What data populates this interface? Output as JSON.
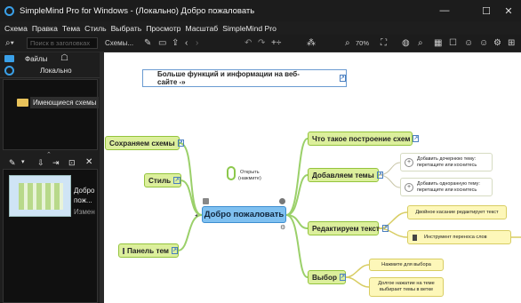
{
  "window": {
    "title": "SimpleMind Pro for Windows - (Локально) Добро пожаловать",
    "controls": [
      "—",
      "☐",
      "✕"
    ]
  },
  "menu": [
    "Схема",
    "Правка",
    "Тема",
    "Стиль",
    "Выбрать",
    "Просмотр",
    "Масштаб",
    "SimpleMind Pro"
  ],
  "toolbar": {
    "search_placeholder": "Поиск в заголовках",
    "maps_label": "Схемы...",
    "zoom": "70%"
  },
  "sidebar": {
    "files_label": "Файлы",
    "local_label": "Локально",
    "existing_maps": "Имеющиеся схемы",
    "thumb_lines": [
      "Добро",
      "пож...",
      "Измен"
    ]
  },
  "map": {
    "banner": "Больше функций и информации на веб-сайте -»",
    "central": "Добро пожаловать",
    "open_hint": [
      "Открыть",
      "(нажмите)"
    ],
    "left_topics": {
      "save": "Сохраняем схемы",
      "style": "Стиль",
      "panel": "Панель тем"
    },
    "right_topics": {
      "what": "Что такое построение схем",
      "add": "Добавляем темы",
      "edit": "Редактируем текст",
      "select": "Выбор"
    },
    "subs": {
      "child": "Добавить дочернюю тему: перетащите или коснитесь",
      "sibling": "Добавить одноранную тему: перетащите или коснитесь"
    },
    "notes": {
      "double_tap": "Двойное касание редактирует текст",
      "word_tool": "Инструмент переноса слов",
      "tap_select": "Нажмите для выбора",
      "long_press": "Долгое нажатие на теме выбирает темы в ветке"
    }
  },
  "colors": {
    "topic_fill": "#dcef9c",
    "topic_border": "#94c43d",
    "central_fill": "#7fc0f0",
    "note_fill": "#fdf7b9",
    "accent": "#3aa0e8"
  }
}
